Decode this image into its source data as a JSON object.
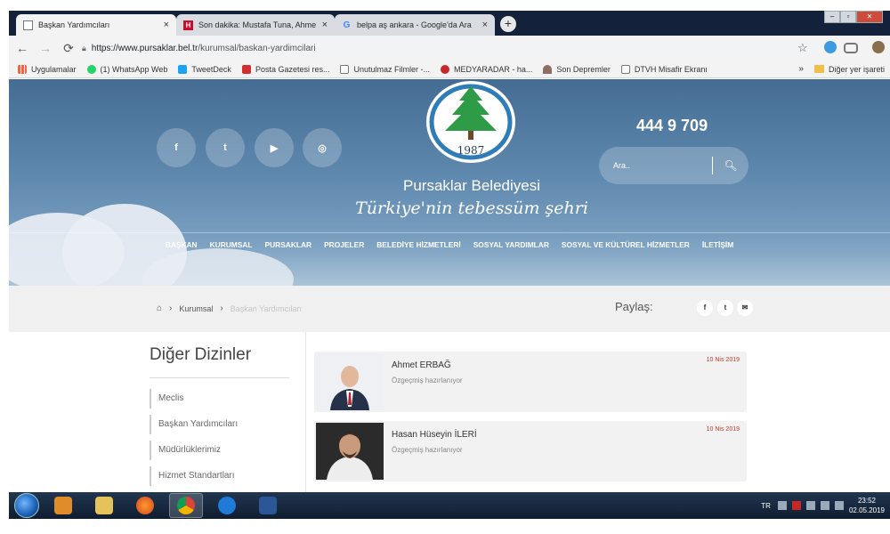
{
  "browser": {
    "tabs": [
      {
        "title": "Başkan Yardımcıları",
        "close": "×"
      },
      {
        "title": "Son dakika: Mustafa Tuna, Ahme",
        "close": "×"
      },
      {
        "title": "belpa aş ankara - Google'da Ara",
        "close": "×"
      }
    ],
    "new_tab": "+",
    "url_host": "https://www.pursaklar.bel.tr",
    "url_path": "/kurumsal/baskan-yardimcilari",
    "bookmarks": [
      {
        "label": "Uygulamalar",
        "icon": "apps-icon"
      },
      {
        "label": "(1) WhatsApp Web",
        "icon": "whatsapp-icon"
      },
      {
        "label": "TweetDeck",
        "icon": "tweetdeck-icon"
      },
      {
        "label": "Posta Gazetesi res...",
        "icon": "posta-icon"
      },
      {
        "label": "Unutulmaz Filmler -...",
        "icon": "page-icon"
      },
      {
        "label": "MEDYARADAR - ha...",
        "icon": "medyaradar-icon"
      },
      {
        "label": "Son Depremler",
        "icon": "quake-icon"
      },
      {
        "label": "DTVH Misafir Ekranı",
        "icon": "page-icon"
      }
    ],
    "bookmarks_more": "»",
    "other_bookmarks": "Diğer yer işareti"
  },
  "site": {
    "social": [
      "f",
      "t",
      "▶",
      "◎"
    ],
    "logo_year": "1987",
    "brand": "Pursaklar Belediyesi",
    "slogan": "Türkiye'nin tebessüm şehri",
    "phone": "444 9 709",
    "search_placeholder": "Ara..",
    "nav": [
      "BAŞKAN",
      "KURUMSAL",
      "PURSAKLAR",
      "PROJELER",
      "BELEDİYE HİZMETLERİ",
      "SOSYAL YARDIMLAR",
      "SOSYAL VE KÜLTÜREL HİZMETLER",
      "İLETİŞİM"
    ],
    "breadcrumb": [
      "Kurumsal",
      "Başkan Yardımcıları"
    ],
    "share_label": "Paylaş:",
    "share_icons": [
      "f",
      "t",
      "✉"
    ],
    "sidebar_title": "Diğer Dizinler",
    "sidebar_items": [
      "Meclis",
      "Başkan Yardımcıları",
      "Müdürlüklerimiz",
      "Hizmet Standartları"
    ],
    "people": [
      {
        "name": "Ahmet ERBAĞ",
        "bio": "Özgeçmiş hazırlanıyor",
        "date": "10 Nis 2019"
      },
      {
        "name": "Hasan Hüseyin İLERİ",
        "bio": "Özgeçmiş hazırlanıyor",
        "date": "10 Nis 2019"
      }
    ]
  },
  "taskbar": {
    "lang": "TR",
    "time": "23:52",
    "date": "02.05.2019"
  },
  "colors": {
    "hero_top": "#456d93",
    "date_red": "#c0392b",
    "taskbar": "#17263d"
  }
}
